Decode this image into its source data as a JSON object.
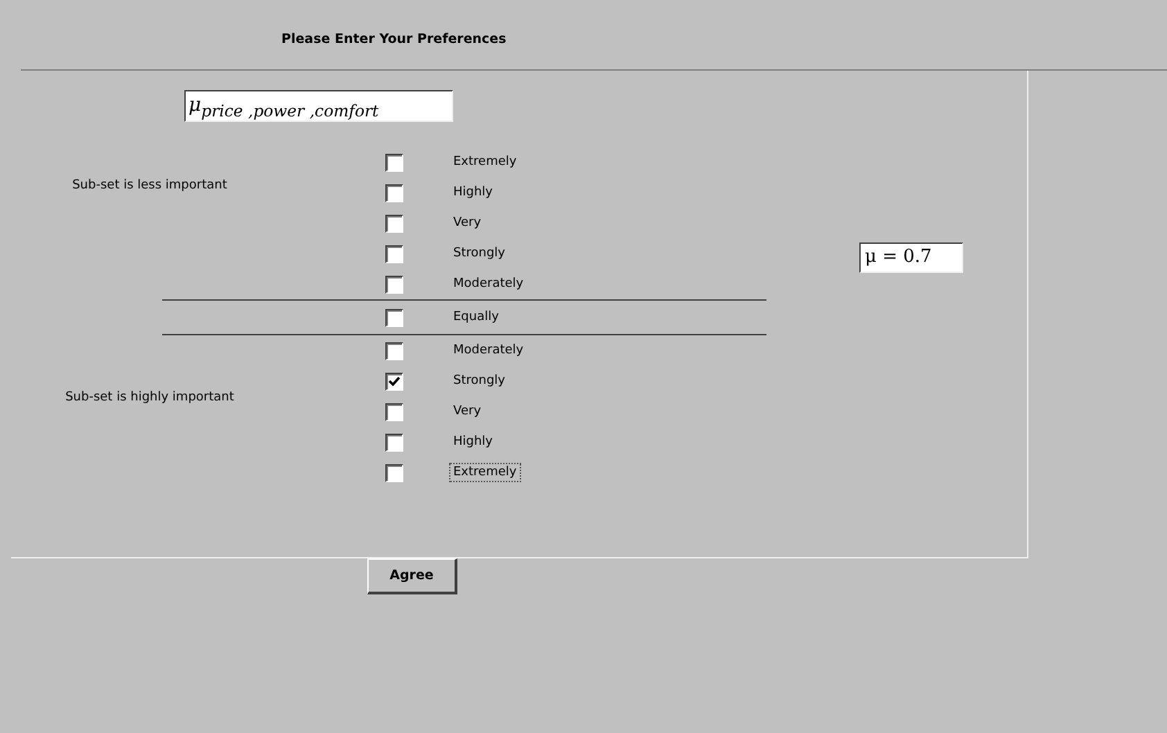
{
  "title": "Please Enter Your Preferences",
  "formula": "μ$_{price ,power ,comfort}$",
  "result": "μ = 0.7",
  "groups": [
    {
      "kind": "upper",
      "label": "Sub-set is less important",
      "options": [
        {
          "label": "Extremely",
          "checked": false,
          "focused": false
        },
        {
          "label": "Highly",
          "checked": false,
          "focused": false
        },
        {
          "label": "Very",
          "checked": false,
          "focused": false
        },
        {
          "label": "Strongly",
          "checked": false,
          "focused": false
        },
        {
          "label": "Moderately",
          "checked": false,
          "focused": false
        }
      ]
    },
    {
      "kind": "neutral",
      "options": [
        {
          "label": "Equally",
          "checked": false,
          "focused": false
        }
      ]
    },
    {
      "kind": "lower",
      "label": "Sub-set is highly important",
      "options": [
        {
          "label": "Moderately",
          "checked": false,
          "focused": false
        },
        {
          "label": "Strongly",
          "checked": true,
          "focused": false
        },
        {
          "label": "Very",
          "checked": false,
          "focused": false
        },
        {
          "label": "Highly",
          "checked": false,
          "focused": false
        },
        {
          "label": "Extremely",
          "checked": false,
          "focused": true
        }
      ]
    }
  ],
  "button": "Agree"
}
